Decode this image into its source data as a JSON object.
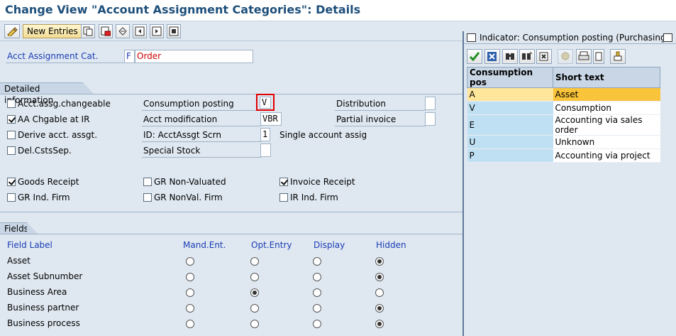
{
  "window": {
    "title": "Change View \"Account Assignment Categories\": Details"
  },
  "toolbar": {
    "new_entries_label": "New Entries"
  },
  "header": {
    "acct_label": "Acct Assignment Cat.",
    "acct_key": "F",
    "acct_value": "Order"
  },
  "detailed": {
    "section_label": "Detailed information",
    "cb_acct_changeable": "Acct.assg.changeable",
    "cb_aa_chgable": "AA Chgable at IR",
    "cb_derive": "Derive acct. assgt.",
    "cb_delcsts": "Del.CstsSep.",
    "consumption_label": "Consumption posting",
    "consumption_value": "V",
    "acct_mod_label": "Acct modification",
    "acct_mod_value": "VBR",
    "id_scrn_label": "ID: AcctAssgt Scrn",
    "id_scrn_value": "1",
    "id_scrn_text": "Single account assig",
    "special_stock_label": "Special Stock",
    "distribution_label": "Distribution",
    "partial_invoice_label": "Partial invoice",
    "cb_goods_receipt": "Goods Receipt",
    "cb_gr_non_valuated": "GR Non-Valuated",
    "cb_invoice_receipt": "Invoice Receipt",
    "cb_gr_ind_firm": "GR Ind. Firm",
    "cb_gr_nonval_firm": "GR NonVal. Firm",
    "cb_ir_ind_firm": "IR Ind. Firm"
  },
  "fields": {
    "section_label": "Fields",
    "headers": {
      "label": "Field Label",
      "mand": "Mand.Ent.",
      "opt": "Opt.Entry",
      "display": "Display",
      "hidden": "Hidden"
    },
    "rows": [
      {
        "label": "Asset",
        "selected": "hidden"
      },
      {
        "label": "Asset Subnumber",
        "selected": "hidden"
      },
      {
        "label": "Business Area",
        "selected": "opt"
      },
      {
        "label": "Business partner",
        "selected": "hidden"
      },
      {
        "label": "Business process",
        "selected": "hidden"
      }
    ]
  },
  "popup": {
    "title": "Indicator: Consumption posting (Purchasing)",
    "col_key": "Consumption pos",
    "col_text": "Short text",
    "rows": [
      {
        "key": "A",
        "text": "Asset"
      },
      {
        "key": "V",
        "text": "Consumption"
      },
      {
        "key": "E",
        "text": "Accounting via sales order"
      },
      {
        "key": "U",
        "text": "Unknown"
      },
      {
        "key": "P",
        "text": "Accounting via project"
      }
    ]
  },
  "colors": {
    "title": "#1d4f7a",
    "label_blue": "#1a3bb3",
    "value_red": "#cc0000",
    "highlight_border": "#e00000",
    "selected_row": "#f9c43a"
  }
}
